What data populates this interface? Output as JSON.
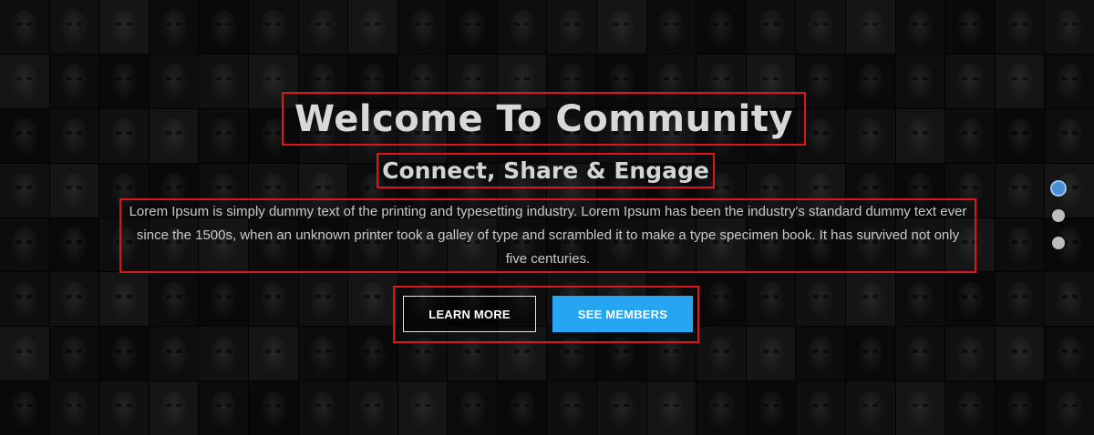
{
  "hero": {
    "title": "Welcome To Community",
    "subtitle": "Connect, Share & Engage",
    "description": "Lorem Ipsum is simply dummy text of the printing and typesetting industry. Lorem Ipsum has been the industry's standard dummy text ever since the 1500s, when an unknown printer took a galley of type and scrambled it to make a type specimen book. It has survived not only five centuries.",
    "buttons": {
      "learn_more": "LEARN MORE",
      "see_members": "SEE MEMBERS"
    }
  },
  "slider": {
    "slides": 3,
    "active_index": 0
  },
  "colors": {
    "highlight_border": "#e0151b",
    "primary_button": "#26a5f2",
    "active_dot": "#4a8fd6",
    "inactive_dot": "#bdbdbd"
  }
}
